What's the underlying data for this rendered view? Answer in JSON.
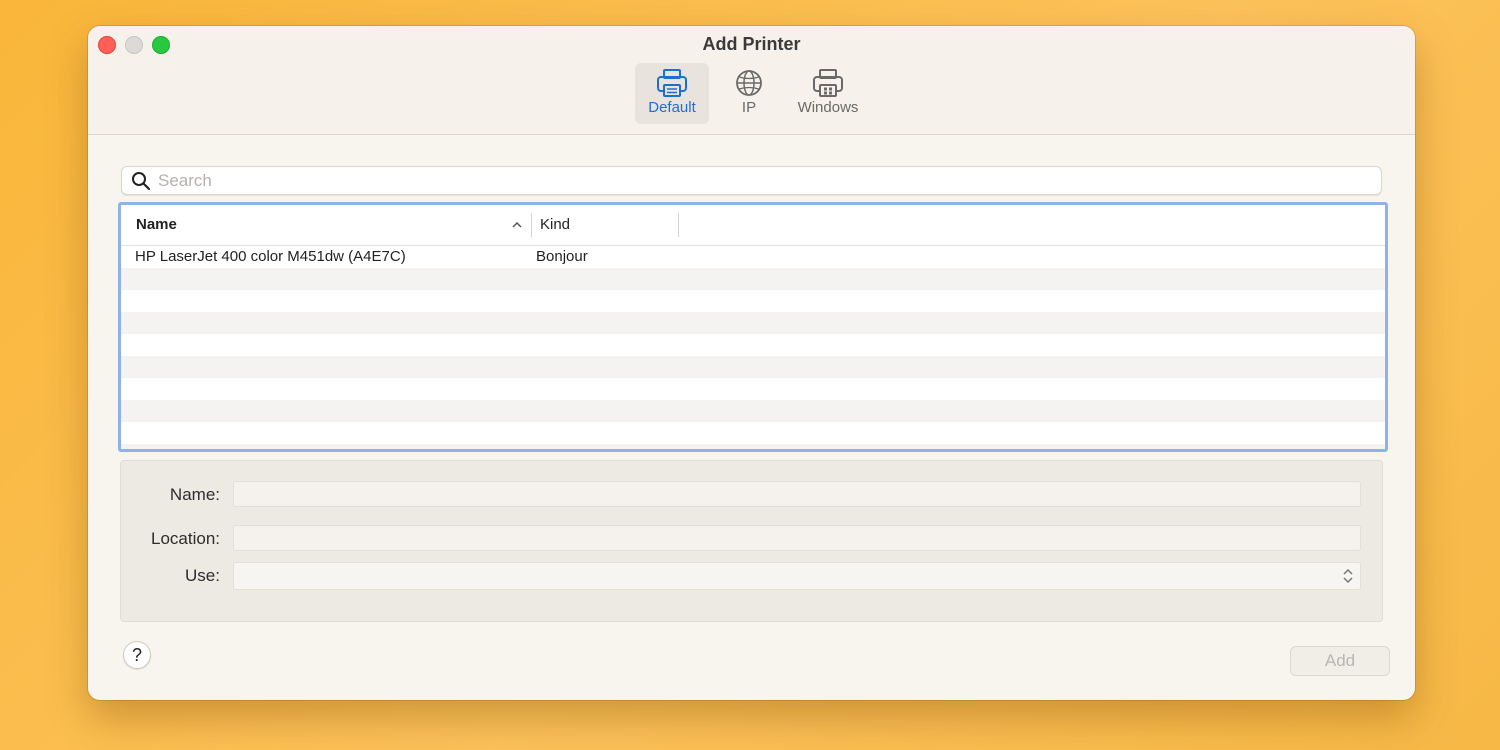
{
  "window": {
    "title": "Add Printer"
  },
  "toolbar": {
    "items": [
      {
        "label": "Default",
        "icon": "printer-icon",
        "selected": true
      },
      {
        "label": "IP",
        "icon": "globe-icon",
        "selected": false
      },
      {
        "label": "Windows",
        "icon": "windows-printer-icon",
        "selected": false
      }
    ]
  },
  "search": {
    "placeholder": "Search",
    "value": ""
  },
  "printer_list": {
    "columns": [
      "Name",
      "Kind"
    ],
    "sorted_column": "Name",
    "rows": [
      {
        "name": "HP LaserJet 400 color M451dw (A4E7C)",
        "kind": "Bonjour"
      }
    ]
  },
  "form": {
    "name_label": "Name:",
    "name_value": "",
    "location_label": "Location:",
    "location_value": "",
    "use_label": "Use:",
    "use_value": ""
  },
  "footer": {
    "help_label": "?",
    "add_label": "Add"
  },
  "colors": {
    "accent": "#1f6fd1",
    "selection_border": "#8eb3ea"
  }
}
